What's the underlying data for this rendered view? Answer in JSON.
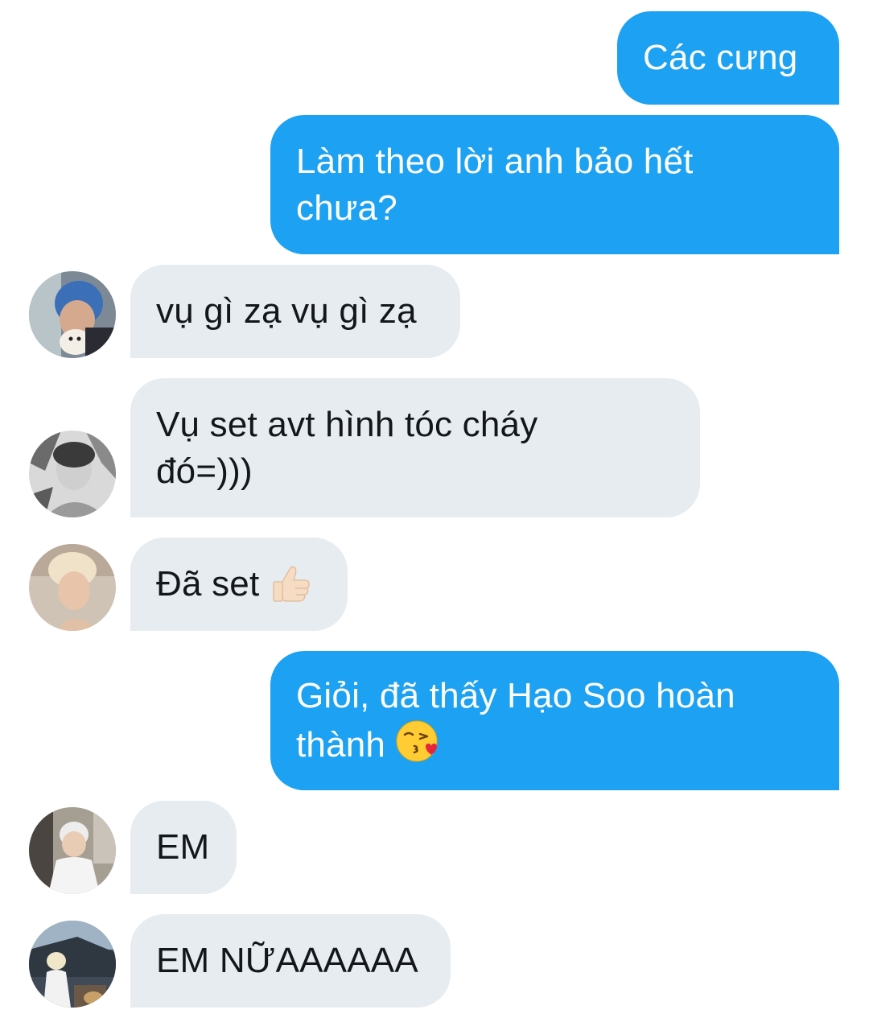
{
  "messages": [
    {
      "id": "m1",
      "direction": "outgoing",
      "text": "Các cưng"
    },
    {
      "id": "m2",
      "direction": "outgoing",
      "text": "Làm theo lời anh bảo hết\nchưa?"
    },
    {
      "id": "m3",
      "direction": "incoming",
      "text": "vụ gì zạ vụ gì zạ",
      "avatar": "avatar-blue-hair"
    },
    {
      "id": "m4",
      "direction": "incoming",
      "text": "Vụ set avt hình tóc cháy\nđó=)))",
      "avatar": "avatar-monochrome"
    },
    {
      "id": "m5",
      "direction": "incoming",
      "text": "Đã set",
      "emoji": "thumbs-up-icon",
      "avatar": "avatar-blonde"
    },
    {
      "id": "m6",
      "direction": "outgoing",
      "text": "Giỏi, đã thấy Hạo Soo hoàn\nthành",
      "emoji": "kissing-face-icon"
    },
    {
      "id": "m7",
      "direction": "incoming",
      "text": "EM",
      "avatar": "avatar-white-shirt"
    },
    {
      "id": "m8",
      "direction": "incoming",
      "text": "EM NỮAAAAAA",
      "avatar": "avatar-outdoor"
    }
  ],
  "colors": {
    "outgoing_bubble": "#1da1f2",
    "incoming_bubble": "#e6ecf0",
    "incoming_text": "#14171a",
    "outgoing_text": "#ffffff"
  }
}
